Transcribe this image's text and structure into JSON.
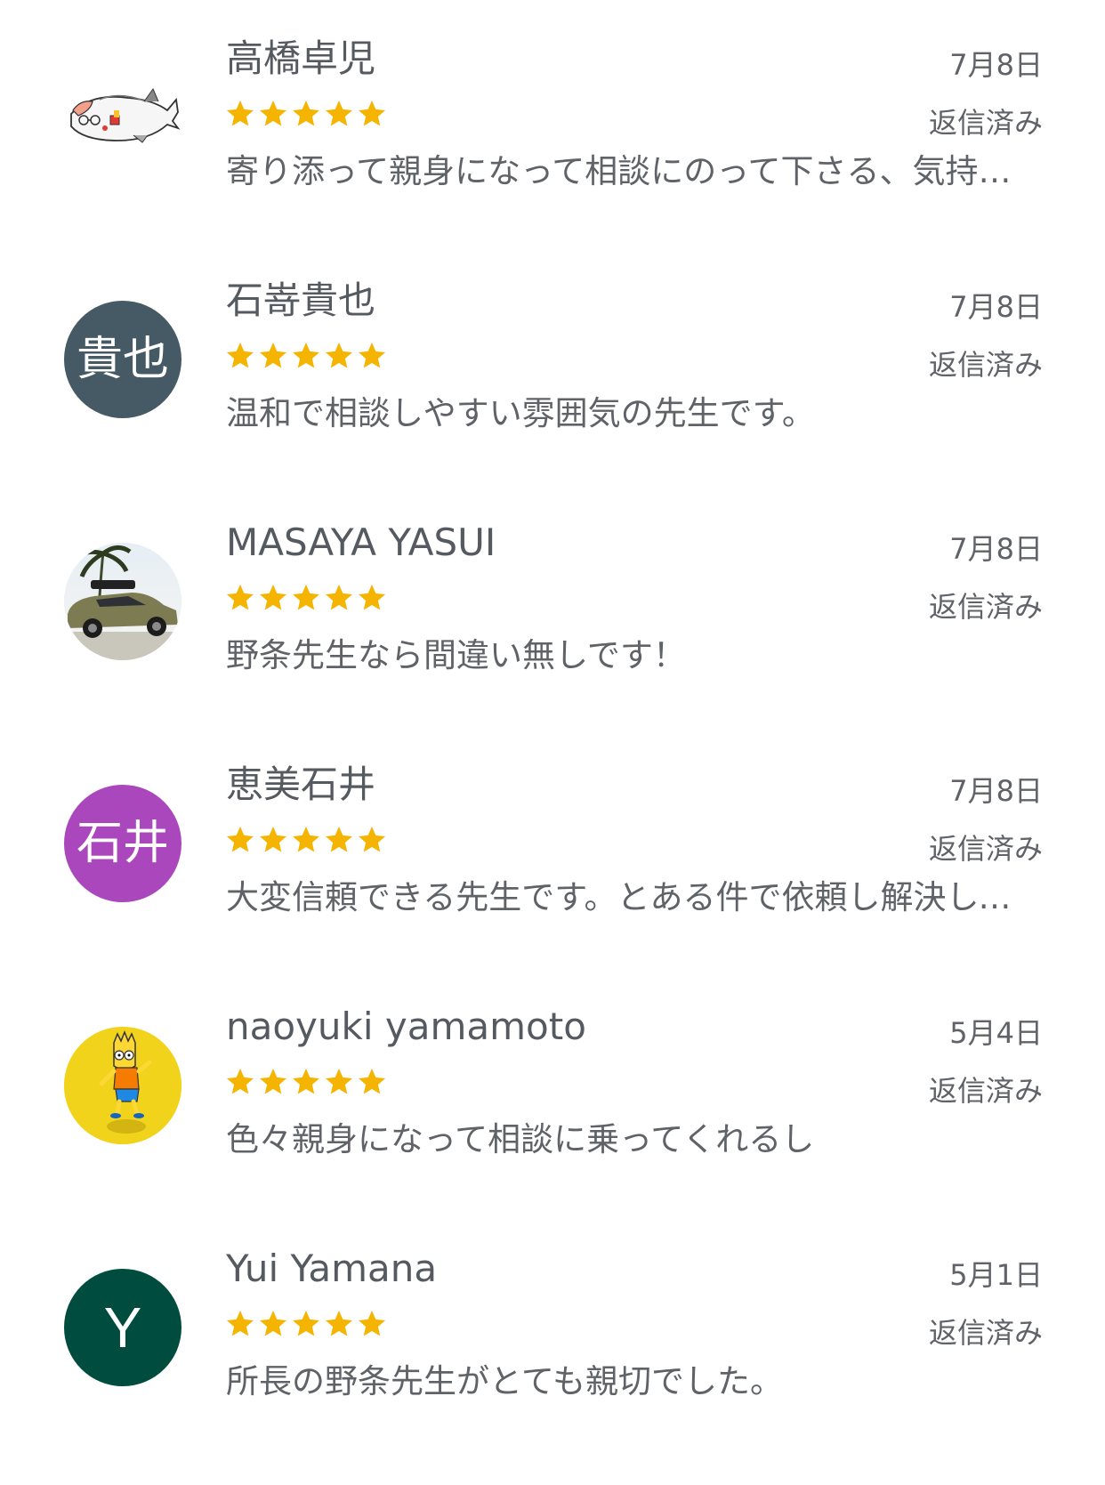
{
  "colors": {
    "star": "#f4b400",
    "text": "#5f6368",
    "avatar_takaya": "#455a64",
    "avatar_ishii": "#ab47bc",
    "avatar_yui": "#004d40"
  },
  "reviews": [
    {
      "name": "高橋卓児",
      "date": "7月8日",
      "rating": 5,
      "reply_status": "返信済み",
      "text": "寄り添って親身になって相談にのって下さる、気持ちの良い先生です。",
      "avatar": {
        "type": "image",
        "icon": "fish-illustration-icon"
      }
    },
    {
      "name": "石嵜貴也",
      "date": "7月8日",
      "rating": 5,
      "reply_status": "返信済み",
      "text": "温和で相談しやすい雰囲気の先生です。",
      "avatar": {
        "type": "initials",
        "initials": "貴也",
        "color": "#455a64"
      }
    },
    {
      "name": "MASAYA YASUI",
      "date": "7月8日",
      "rating": 5,
      "reply_status": "返信済み",
      "text": "野条先生なら間違い無しです！",
      "avatar": {
        "type": "image",
        "icon": "car-photo-icon"
      }
    },
    {
      "name": "恵美石井",
      "date": "7月8日",
      "rating": 5,
      "reply_status": "返信済み",
      "text": "大変信頼できる先生です。とある件で依頼し解決していただきました。",
      "avatar": {
        "type": "initials",
        "initials": "石井",
        "color": "#ab47bc"
      }
    },
    {
      "name": "naoyuki yamamoto",
      "date": "5月4日",
      "rating": 5,
      "reply_status": "返信済み",
      "text": "色々親身になって相談に乗ってくれるし",
      "avatar": {
        "type": "image",
        "icon": "cartoon-character-icon"
      }
    },
    {
      "name": "Yui Yamana",
      "date": "5月1日",
      "rating": 5,
      "reply_status": "返信済み",
      "text": "所長の野条先生がとても親切でした。",
      "avatar": {
        "type": "initials",
        "initials": "Y",
        "color": "#004d40"
      }
    }
  ]
}
